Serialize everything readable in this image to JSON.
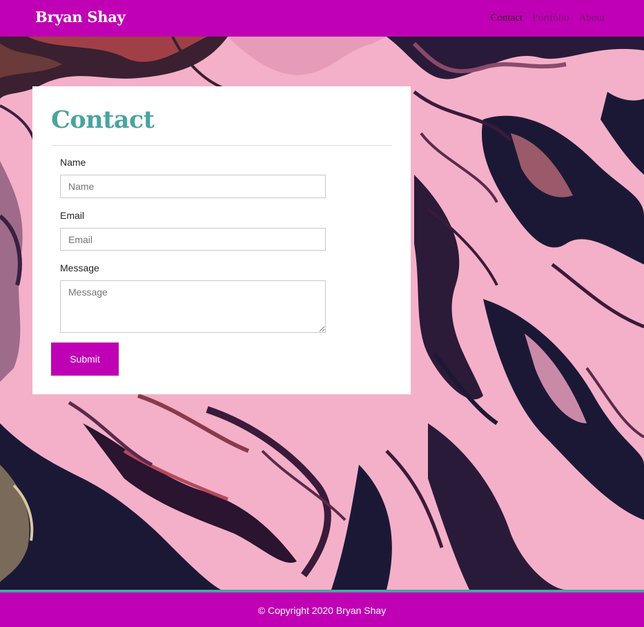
{
  "colors": {
    "accent": "#c000b4",
    "heading": "#4aa3a0",
    "footer_stripe": "#4aa3a0",
    "background_pink": "#f4b0c8",
    "marble_dark": "#1b1836"
  },
  "navbar": {
    "brand": "Bryan Shay",
    "links": [
      {
        "label": "Contact",
        "active": true
      },
      {
        "label": "Portfolio",
        "active": false
      },
      {
        "label": "About",
        "active": false
      }
    ]
  },
  "contact_form": {
    "title": "Contact",
    "fields": {
      "name": {
        "label": "Name",
        "placeholder": "Name",
        "value": ""
      },
      "email": {
        "label": "Email",
        "placeholder": "Email",
        "value": ""
      },
      "message": {
        "label": "Message",
        "placeholder": "Message",
        "value": ""
      }
    },
    "submit_label": "Submit"
  },
  "footer": {
    "text": "© Copyright 2020 Bryan Shay"
  }
}
